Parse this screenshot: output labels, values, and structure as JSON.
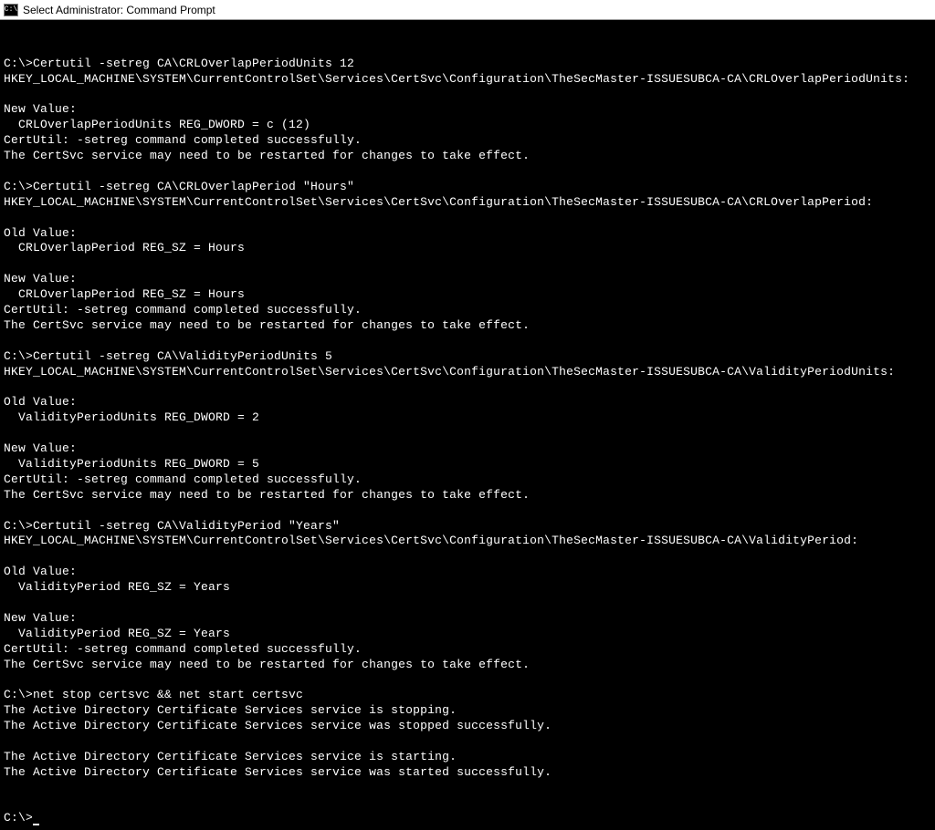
{
  "titlebar": {
    "icon_text": "C:\\",
    "title": "Select Administrator: Command Prompt"
  },
  "terminal": {
    "prompt": "C:\\>",
    "lines": [
      "",
      "C:\\>Certutil -setreg CA\\CRLOverlapPeriodUnits 12",
      "HKEY_LOCAL_MACHINE\\SYSTEM\\CurrentControlSet\\Services\\CertSvc\\Configuration\\TheSecMaster-ISSUESUBCA-CA\\CRLOverlapPeriodUnits:",
      "",
      "New Value:",
      "  CRLOverlapPeriodUnits REG_DWORD = c (12)",
      "CertUtil: -setreg command completed successfully.",
      "The CertSvc service may need to be restarted for changes to take effect.",
      "",
      "C:\\>Certutil -setreg CA\\CRLOverlapPeriod \"Hours\"",
      "HKEY_LOCAL_MACHINE\\SYSTEM\\CurrentControlSet\\Services\\CertSvc\\Configuration\\TheSecMaster-ISSUESUBCA-CA\\CRLOverlapPeriod:",
      "",
      "Old Value:",
      "  CRLOverlapPeriod REG_SZ = Hours",
      "",
      "New Value:",
      "  CRLOverlapPeriod REG_SZ = Hours",
      "CertUtil: -setreg command completed successfully.",
      "The CertSvc service may need to be restarted for changes to take effect.",
      "",
      "C:\\>Certutil -setreg CA\\ValidityPeriodUnits 5",
      "HKEY_LOCAL_MACHINE\\SYSTEM\\CurrentControlSet\\Services\\CertSvc\\Configuration\\TheSecMaster-ISSUESUBCA-CA\\ValidityPeriodUnits:",
      "",
      "Old Value:",
      "  ValidityPeriodUnits REG_DWORD = 2",
      "",
      "New Value:",
      "  ValidityPeriodUnits REG_DWORD = 5",
      "CertUtil: -setreg command completed successfully.",
      "The CertSvc service may need to be restarted for changes to take effect.",
      "",
      "C:\\>Certutil -setreg CA\\ValidityPeriod \"Years\"",
      "HKEY_LOCAL_MACHINE\\SYSTEM\\CurrentControlSet\\Services\\CertSvc\\Configuration\\TheSecMaster-ISSUESUBCA-CA\\ValidityPeriod:",
      "",
      "Old Value:",
      "  ValidityPeriod REG_SZ = Years",
      "",
      "New Value:",
      "  ValidityPeriod REG_SZ = Years",
      "CertUtil: -setreg command completed successfully.",
      "The CertSvc service may need to be restarted for changes to take effect.",
      "",
      "C:\\>net stop certsvc && net start certsvc",
      "The Active Directory Certificate Services service is stopping.",
      "The Active Directory Certificate Services service was stopped successfully.",
      "",
      "The Active Directory Certificate Services service is starting.",
      "The Active Directory Certificate Services service was started successfully.",
      "",
      ""
    ],
    "final_prompt": "C:\\>"
  }
}
